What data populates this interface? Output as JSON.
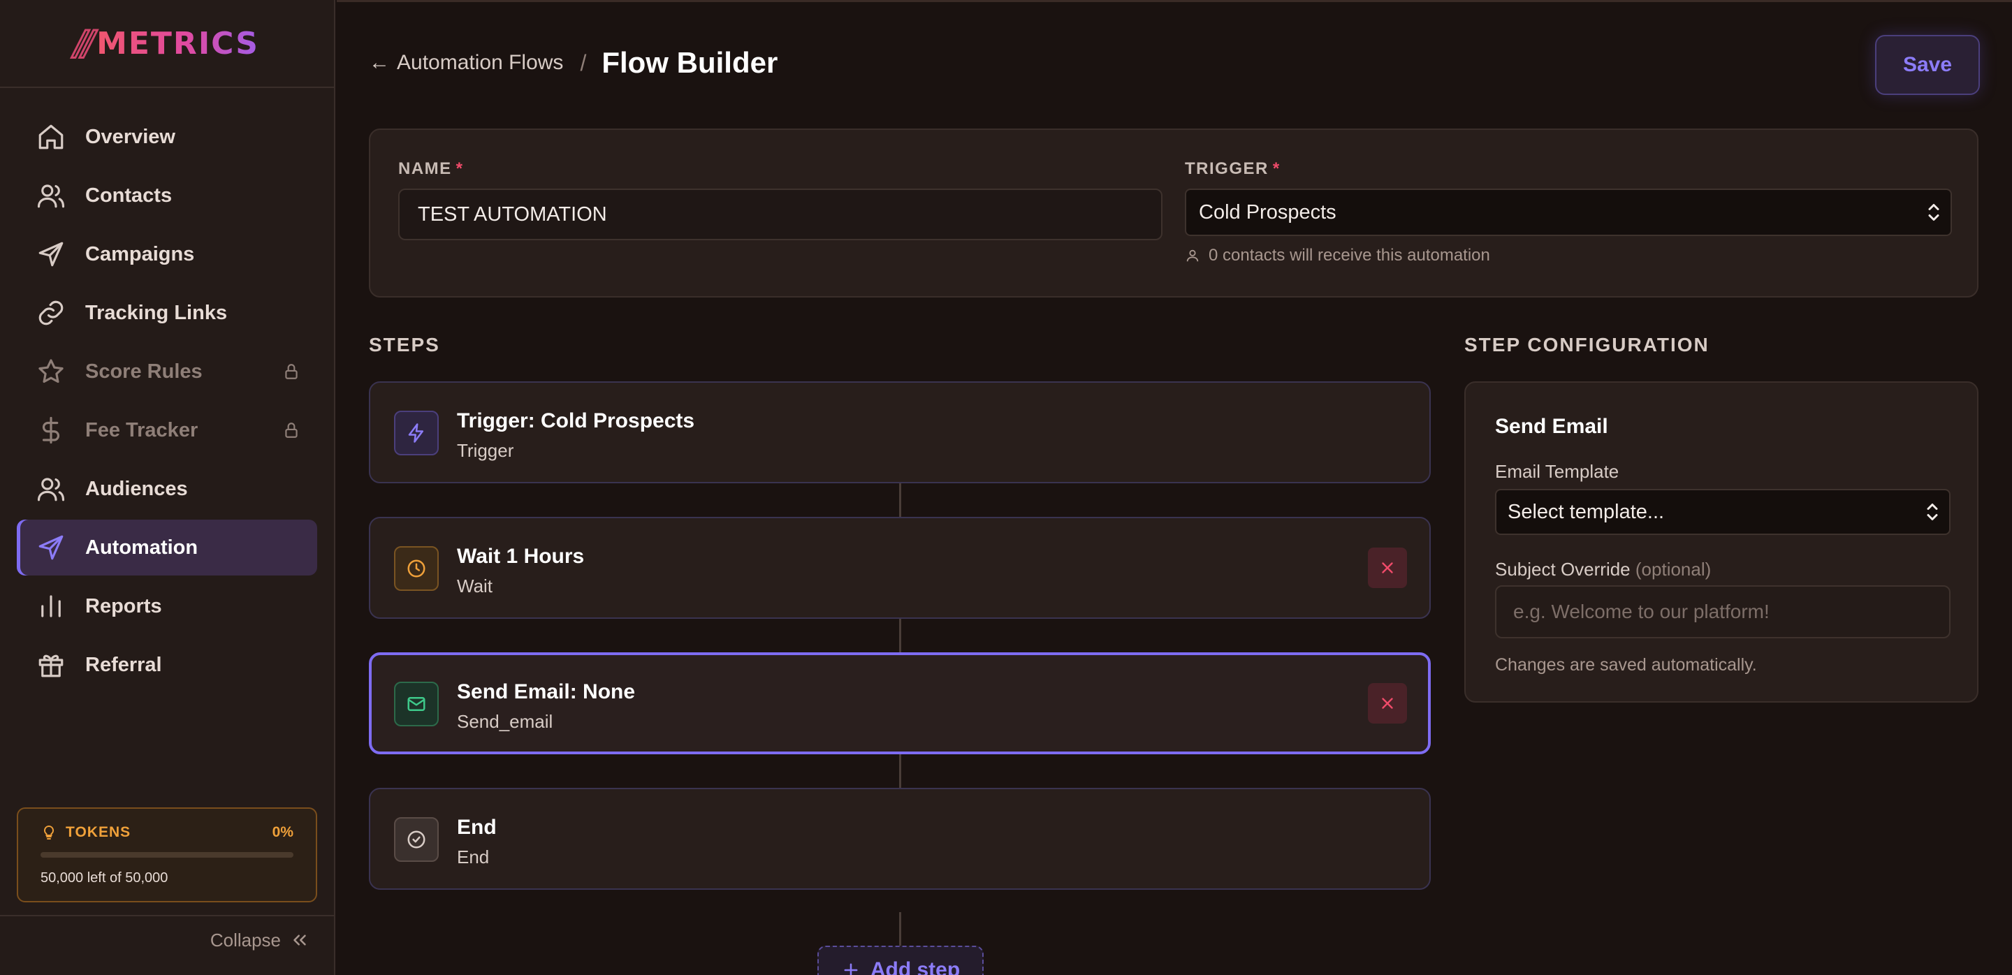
{
  "brand": {
    "slashes": "//",
    "name": "METRICS"
  },
  "sidebar": {
    "items": [
      {
        "label": "Overview",
        "icon": "home-icon"
      },
      {
        "label": "Contacts",
        "icon": "users-icon"
      },
      {
        "label": "Campaigns",
        "icon": "send-icon"
      },
      {
        "label": "Tracking Links",
        "icon": "link-icon"
      },
      {
        "label": "Score Rules",
        "icon": "star-icon",
        "locked": true
      },
      {
        "label": "Fee Tracker",
        "icon": "dollar-icon",
        "locked": true
      },
      {
        "label": "Audiences",
        "icon": "users-icon"
      },
      {
        "label": "Automation",
        "icon": "send-icon",
        "active": true
      },
      {
        "label": "Reports",
        "icon": "bar-chart-icon"
      },
      {
        "label": "Referral",
        "icon": "gift-icon"
      }
    ],
    "tokens": {
      "title": "TOKENS",
      "percent_label": "0%",
      "used_fraction": 0,
      "summary": "50,000 left of 50,000"
    },
    "collapse_label": "Collapse"
  },
  "header": {
    "back_label": "Automation Flows",
    "separator": "/",
    "title": "Flow Builder",
    "save_label": "Save"
  },
  "form": {
    "name_label": "NAME",
    "name_value": "TEST AUTOMATION",
    "trigger_label": "TRIGGER",
    "trigger_value": "Cold Prospects",
    "required_mark": "*",
    "trigger_note": "0 contacts will receive this automation"
  },
  "steps": {
    "title": "STEPS",
    "items": [
      {
        "title": "Trigger: Cold Prospects",
        "type": "Trigger",
        "icon": "bolt-icon",
        "color": "#7e6cf2"
      },
      {
        "title": "Wait 1 Hours",
        "type": "Wait",
        "icon": "clock-icon",
        "color": "#f0a13a"
      },
      {
        "title": "Send Email: None",
        "type": "Send_email",
        "icon": "mail-icon",
        "color": "#3ec98a",
        "selected": true
      },
      {
        "title": "End",
        "type": "End",
        "icon": "check-circle-icon",
        "color": "#d8ccc6"
      }
    ],
    "add_label": "Add step"
  },
  "config": {
    "title": "STEP CONFIGURATION",
    "heading": "Send Email",
    "template_label": "Email Template",
    "template_value": "Select template...",
    "subject_label": "Subject Override",
    "subject_optional": "(optional)",
    "subject_placeholder": "e.g. Welcome to our platform!",
    "note": "Changes are saved automatically."
  },
  "colors": {
    "accent": "#7e6cf2",
    "danger": "#f04b6a",
    "warning": "#f0a13a",
    "success": "#3ec98a"
  }
}
